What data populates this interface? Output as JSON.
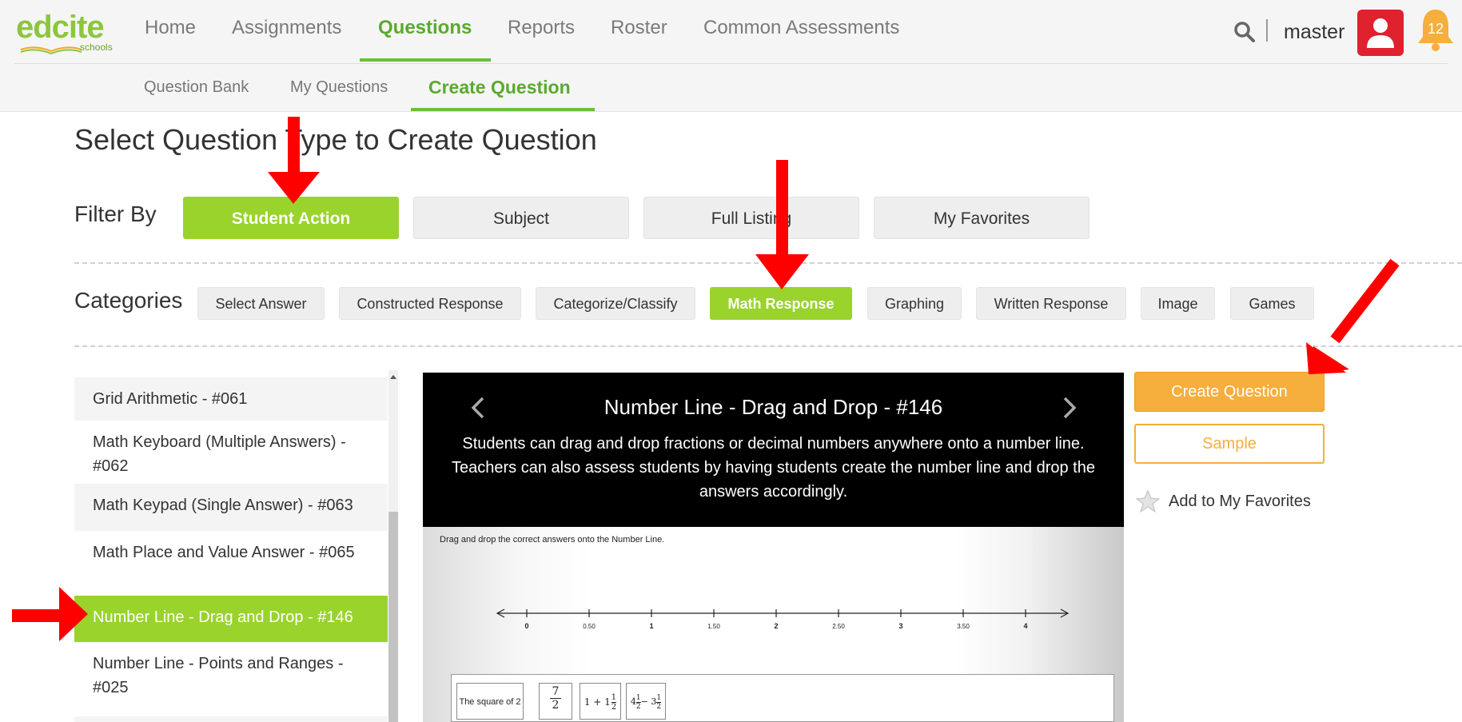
{
  "header": {
    "logo": {
      "brand": "edcite",
      "sub": "schools"
    },
    "nav": [
      {
        "label": "Home",
        "active": false
      },
      {
        "label": "Assignments",
        "active": false
      },
      {
        "label": "Questions",
        "active": true
      },
      {
        "label": "Reports",
        "active": false
      },
      {
        "label": "Roster",
        "active": false
      },
      {
        "label": "Common Assessments",
        "active": false
      }
    ],
    "subnav": [
      {
        "label": "Question Bank",
        "active": false
      },
      {
        "label": "My Questions",
        "active": false
      },
      {
        "label": "Create Question",
        "active": true
      }
    ],
    "username": "master",
    "notification_count": "12"
  },
  "main": {
    "title": "Select Question Type to Create Question",
    "filter_label": "Filter By",
    "filters": [
      {
        "label": "Student Action",
        "active": true
      },
      {
        "label": "Subject",
        "active": false
      },
      {
        "label": "Full Listing",
        "active": false
      },
      {
        "label": "My Favorites",
        "active": false
      }
    ],
    "categories_label": "Categories",
    "categories": [
      {
        "label": "Select Answer",
        "active": false
      },
      {
        "label": "Constructed Response",
        "active": false
      },
      {
        "label": "Categorize/Classify",
        "active": false
      },
      {
        "label": "Math Response",
        "active": true
      },
      {
        "label": "Graphing",
        "active": false
      },
      {
        "label": "Written Response",
        "active": false
      },
      {
        "label": "Image",
        "active": false
      },
      {
        "label": "Games",
        "active": false
      }
    ],
    "question_types": [
      {
        "label": "Grid Arithmetic - #061",
        "active": false
      },
      {
        "label": "Math Keyboard (Multiple Answers) - #062",
        "active": false
      },
      {
        "label": "Math Keypad (Single Answer) - #063",
        "active": false
      },
      {
        "label": "Math Place and Value Answer - #065",
        "active": false
      },
      {
        "label": "Number Line - Drag and Drop - #146",
        "active": true
      },
      {
        "label": "Number Line - Points and Ranges - #025",
        "active": false
      }
    ]
  },
  "preview": {
    "title": "Number Line - Drag and Drop - #146",
    "description": "Students can drag and drop fractions or decimal numbers anywhere onto a number line. Teachers can also assess students by having students create the number line and drop the answers accordingly.",
    "instruction": "Drag and drop the correct answers onto the Number Line.",
    "number_line_ticks": [
      "0",
      "0.50",
      "1",
      "1.50",
      "2",
      "2.50",
      "3",
      "3.50",
      "4"
    ],
    "chips": {
      "c1": "The square of 2",
      "c2_num": "7",
      "c2_den": "2",
      "c3_whole": "1 + 1",
      "c3_num": "1",
      "c3_den": "2",
      "c4_a": "4",
      "c4_a_num": "1",
      "c4_a_den": "2",
      "c4_op": "− 3",
      "c4_b_num": "1",
      "c4_b_den": "2"
    }
  },
  "actions": {
    "create": "Create Question",
    "sample": "Sample",
    "favorite": "Add to My Favorites"
  },
  "colors": {
    "brand_green": "#99d32c",
    "accent_orange": "#f6ae3c",
    "alert_red": "#e0212e",
    "annotation_arrow": "#ff0000"
  }
}
